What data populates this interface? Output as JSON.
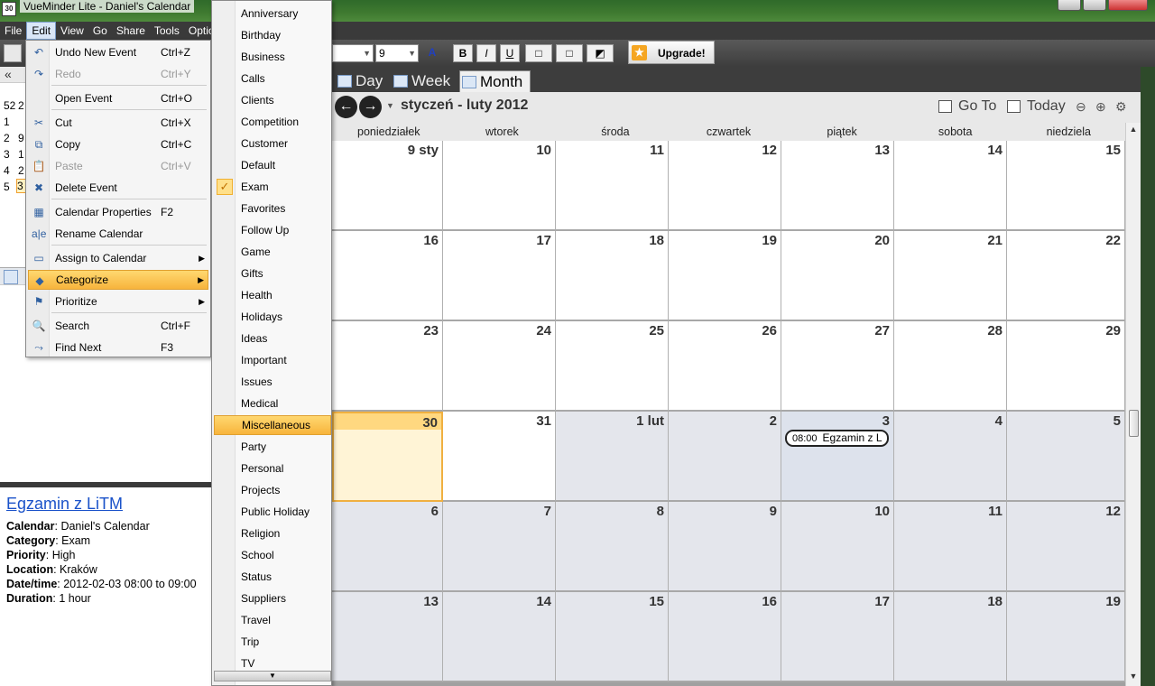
{
  "window": {
    "title": "VueMinder Lite - Daniel's Calendar",
    "app_icon_text": "30"
  },
  "menubar": [
    "File",
    "Edit",
    "View",
    "Go",
    "Share",
    "Tools",
    "Optio"
  ],
  "toolbar": {
    "font_size": "9",
    "upgrade_label": "Upgrade!"
  },
  "edit_menu": [
    {
      "label": "Undo New Event",
      "shortcut": "Ctrl+Z",
      "icon": "undo-icon",
      "glyph": "↶",
      "disabled": false
    },
    {
      "label": "Redo",
      "shortcut": "Ctrl+Y",
      "icon": "redo-icon",
      "glyph": "↷",
      "disabled": true
    },
    {
      "label": "Open Event",
      "shortcut": "Ctrl+O",
      "icon": "",
      "glyph": "",
      "disabled": false
    },
    {
      "label": "Cut",
      "shortcut": "Ctrl+X",
      "icon": "scissors-icon",
      "glyph": "✂",
      "disabled": false
    },
    {
      "label": "Copy",
      "shortcut": "Ctrl+C",
      "icon": "copy-icon",
      "glyph": "⧉",
      "disabled": false
    },
    {
      "label": "Paste",
      "shortcut": "Ctrl+V",
      "icon": "paste-icon",
      "glyph": "📋",
      "disabled": true
    },
    {
      "label": "Delete Event",
      "shortcut": "",
      "icon": "delete-icon",
      "glyph": "✖",
      "disabled": false
    },
    {
      "label": "Calendar Properties",
      "shortcut": "F2",
      "icon": "calendar-properties-icon",
      "glyph": "▦",
      "disabled": false
    },
    {
      "label": "Rename Calendar",
      "shortcut": "",
      "icon": "rename-icon",
      "glyph": "a|e",
      "disabled": false
    },
    {
      "label": "Assign to Calendar",
      "shortcut": "",
      "icon": "calendar-icon",
      "glyph": "▭",
      "disabled": false,
      "submenu": true
    },
    {
      "label": "Categorize",
      "shortcut": "",
      "icon": "tag-icon",
      "glyph": "◆",
      "disabled": false,
      "submenu": true,
      "highlighted": true
    },
    {
      "label": "Prioritize",
      "shortcut": "",
      "icon": "flag-icon",
      "glyph": "⚑",
      "disabled": false,
      "submenu": true
    },
    {
      "label": "Search",
      "shortcut": "Ctrl+F",
      "icon": "search-icon",
      "glyph": "🔍",
      "disabled": false
    },
    {
      "label": "Find Next",
      "shortcut": "F3",
      "icon": "find-next-icon",
      "glyph": "⤳",
      "disabled": false
    }
  ],
  "categories": [
    "Anniversary",
    "Birthday",
    "Business",
    "Calls",
    "Clients",
    "Competition",
    "Customer",
    "Default",
    "Exam",
    "Favorites",
    "Follow Up",
    "Game",
    "Gifts",
    "Health",
    "Holidays",
    "Ideas",
    "Important",
    "Issues",
    "Medical",
    "Miscellaneous",
    "Party",
    "Personal",
    "Projects",
    "Public Holiday",
    "Religion",
    "School",
    "Status",
    "Suppliers",
    "Travel",
    "Trip",
    "TV"
  ],
  "categories_checked": "Exam",
  "categories_highlighted": "Miscellaneous",
  "sidebar": {
    "nav_glyph": "«",
    "week_numbers": [
      "52",
      "1",
      "2",
      "3",
      "4",
      "5"
    ],
    "mini_days": [
      "2",
      "",
      "9",
      "1",
      "2",
      "3"
    ]
  },
  "details": {
    "title": "Egzamin z LiTM",
    "rows": [
      {
        "label": "Calendar",
        "value": "Daniel's Calendar"
      },
      {
        "label": "Category",
        "value": "Exam"
      },
      {
        "label": "Priority",
        "value": "High"
      },
      {
        "label": "Location",
        "value": "Kraków"
      },
      {
        "label": "Date/time",
        "value": "2012-02-03 08:00 to 09:00"
      },
      {
        "label": "Duration",
        "value": "1 hour"
      }
    ]
  },
  "view_tabs": [
    "Day",
    "Week",
    "Month"
  ],
  "active_tab": "Month",
  "range_label": "styczeń - luty 2012",
  "nav_actions": {
    "goto": "Go To",
    "today": "Today"
  },
  "day_headers": [
    "poniedziałek",
    "wtorek",
    "środa",
    "czwartek",
    "piątek",
    "sobota",
    "niedziela"
  ],
  "weeks": [
    [
      "9 sty",
      "10",
      "11",
      "12",
      "13",
      "14",
      "15"
    ],
    [
      "16",
      "17",
      "18",
      "19",
      "20",
      "21",
      "22"
    ],
    [
      "23",
      "24",
      "25",
      "26",
      "27",
      "28",
      "29"
    ],
    [
      "30",
      "31",
      "1 lut",
      "2",
      "3",
      "4",
      "5"
    ],
    [
      "6",
      "7",
      "8",
      "9",
      "10",
      "11",
      "12"
    ],
    [
      "13",
      "14",
      "15",
      "16",
      "17",
      "18",
      "19"
    ]
  ],
  "event": {
    "time": "08:00",
    "title": "Egzamin z L"
  }
}
